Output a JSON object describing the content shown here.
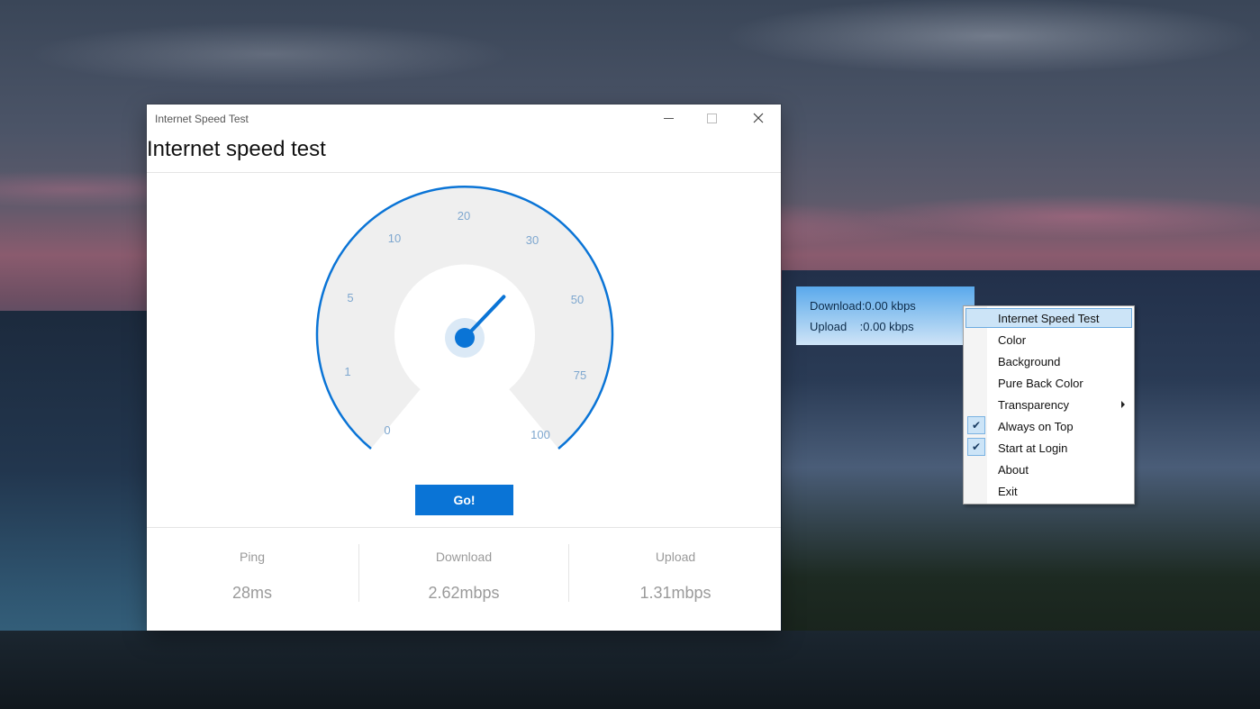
{
  "window": {
    "title": "Internet Speed Test",
    "heading": "Internet speed test"
  },
  "gauge": {
    "ticks": [
      "0",
      "1",
      "5",
      "10",
      "20",
      "30",
      "50",
      "75",
      "100"
    ],
    "needle_value": 0.62,
    "accent_color": "#0a74d6"
  },
  "go_label": "Go!",
  "stats": [
    {
      "label": "Ping",
      "value": "28ms"
    },
    {
      "label": "Download",
      "value": "2.62mbps"
    },
    {
      "label": "Upload",
      "value": "1.31mbps"
    }
  ],
  "mini": {
    "download_line": "Download:0.00 kbps",
    "upload_line": "Upload    :0.00 kbps"
  },
  "menu": {
    "items": [
      {
        "label": "Internet Speed Test",
        "highlighted": true
      },
      {
        "label": "Color"
      },
      {
        "label": "Background"
      },
      {
        "label": "Pure Back Color"
      },
      {
        "label": "Transparency",
        "submenu": true
      },
      {
        "label": "Always on Top",
        "checked": true
      },
      {
        "label": "Start at Login",
        "checked": true
      },
      {
        "label": "About"
      },
      {
        "label": "Exit"
      }
    ]
  }
}
